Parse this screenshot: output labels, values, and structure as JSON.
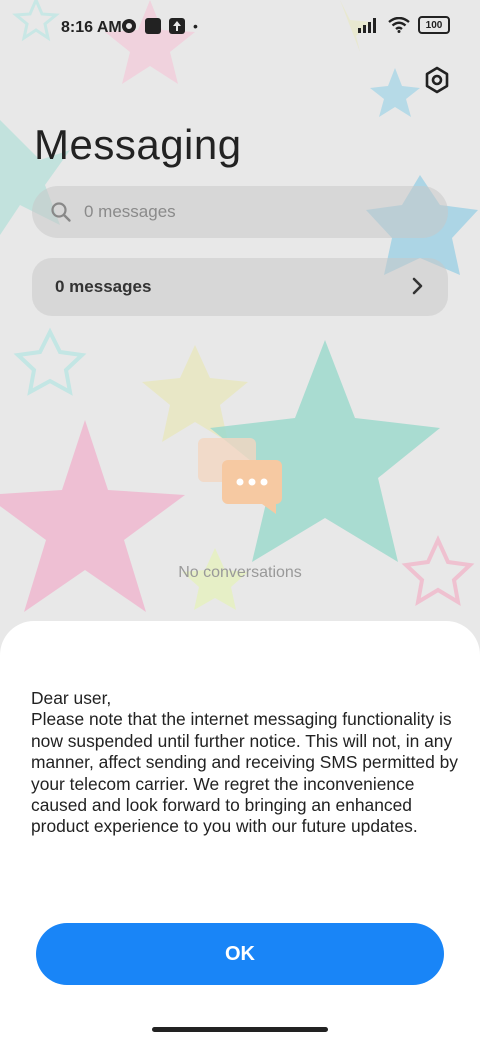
{
  "status_bar": {
    "time": "8:16 AM",
    "battery": "100"
  },
  "header": {
    "title": "Messaging"
  },
  "search": {
    "placeholder": "0 messages"
  },
  "messages_card": {
    "label": "0 messages"
  },
  "empty_state": {
    "text": "No conversations"
  },
  "dialog": {
    "lines": [
      "Dear user,",
      "Please note that the internet messaging functionality is now suspended until further notice. This will not, in any manner, affect sending and receiving SMS permitted by your telecom carrier. We regret the inconvenience caused and look forward to bringing an enhanced product experience to you with our future updates."
    ],
    "ok_label": "OK"
  },
  "colors": {
    "accent": "#1985f7"
  },
  "icons": [
    "settings-icon",
    "search-icon",
    "chevron-right-icon",
    "chat-bubble-icon",
    "wifi-icon",
    "signal-icon",
    "battery-icon"
  ]
}
